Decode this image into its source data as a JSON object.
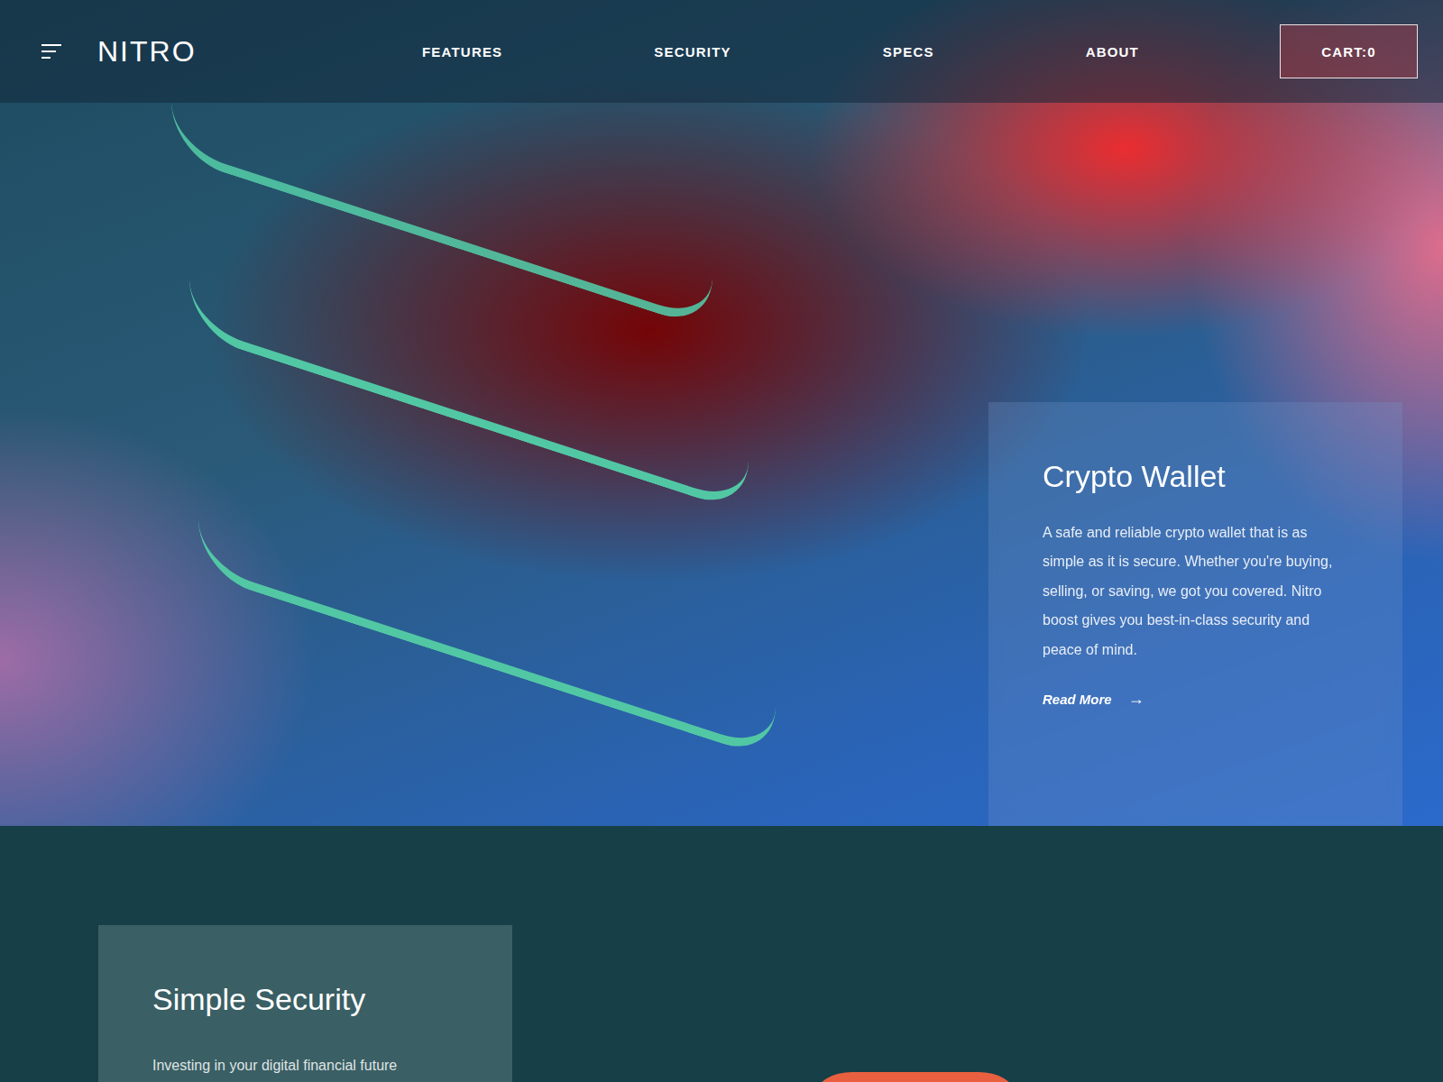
{
  "header": {
    "logo": "NITRO",
    "nav": [
      "FEATURES",
      "SECURITY",
      "SPECS",
      "ABOUT"
    ],
    "cart": "CART:0"
  },
  "hero_card": {
    "title": "Crypto Wallet",
    "body": "A safe and reliable crypto wallet that is as simple as it is secure. Whether you're buying, selling, or saving, we got you covered. Nitro boost gives you best-in-class security and peace of mind.",
    "link": "Read More",
    "link_arrow": "→"
  },
  "security_card": {
    "title": "Simple Security",
    "body": "Investing in your digital financial future"
  }
}
